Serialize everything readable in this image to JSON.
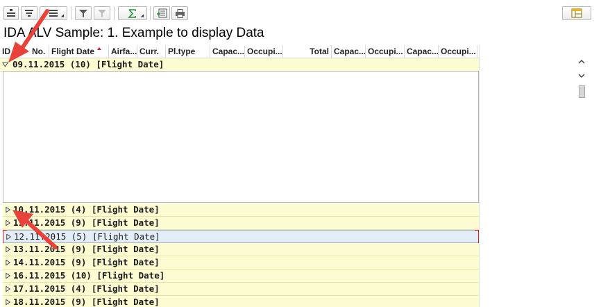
{
  "toolbar": {
    "buttons": [
      {
        "name": "details-button",
        "icon": "details-icon"
      },
      {
        "name": "sort-ascending-button",
        "icon": "sort-ascending-icon"
      },
      {
        "name": "sort-descending-button",
        "icon": "sort-descending-icon"
      },
      {
        "name": "filter-button",
        "icon": "filter-icon"
      },
      {
        "name": "delete-filter-button",
        "icon": "delete-filter-icon"
      },
      {
        "name": "total-button",
        "icon": "sigma-icon"
      },
      {
        "name": "export-button",
        "icon": "export-spreadsheet-icon"
      },
      {
        "name": "print-button",
        "icon": "printer-icon"
      },
      {
        "name": "layout-button",
        "icon": "layout-icon"
      }
    ]
  },
  "title": "IDA ALV Sample: 1. Example to display Data",
  "columns": [
    {
      "label": "ID"
    },
    {
      "label": "No."
    },
    {
      "label": "Flight Date"
    },
    {
      "label": "Airfa..."
    },
    {
      "label": "Curr."
    },
    {
      "label": "Pl.type"
    },
    {
      "label": "Capac..."
    },
    {
      "label": "Occupi..."
    },
    {
      "label": "Total"
    },
    {
      "label": "Capac..."
    },
    {
      "label": "Occupi..."
    },
    {
      "label": "Capac..."
    },
    {
      "label": "Occupi..."
    }
  ],
  "groups": [
    {
      "label": "09.11.2015 (10) [Flight Date]",
      "expanded": true
    },
    {
      "label": "10.11.2015 (4) [Flight Date]",
      "expanded": false
    },
    {
      "label": "11.11.2015 (9) [Flight Date]",
      "expanded": false
    },
    {
      "label": "12.11.2015 (5) [Flight Date]",
      "expanded": false,
      "selected": true
    },
    {
      "label": "13.11.2015 (9) [Flight Date]",
      "expanded": false
    },
    {
      "label": "14.11.2015 (9) [Flight Date]",
      "expanded": false
    },
    {
      "label": "16.11.2015 (10) [Flight Date]",
      "expanded": false
    },
    {
      "label": "17.11.2015 (4) [Flight Date]",
      "expanded": false
    },
    {
      "label": "18.11.2015 (9) [Flight Date]",
      "expanded": false
    }
  ],
  "colors": {
    "group_row": "#fdfbd2",
    "selected_row": "#e3edf7",
    "annotation_arrow": "#e8423a"
  }
}
